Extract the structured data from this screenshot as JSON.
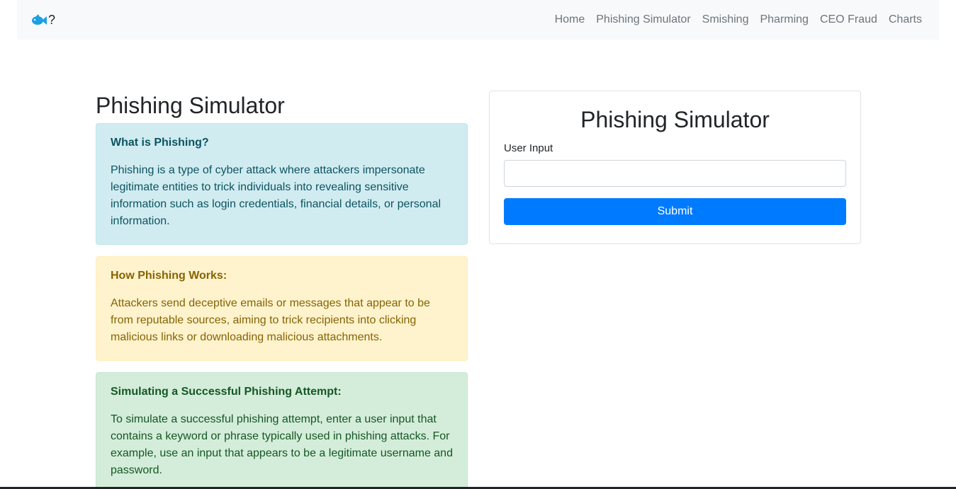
{
  "navbar": {
    "brand_icon": "fish-icon",
    "brand_text": "?",
    "links": [
      "Home",
      "Phishing Simulator",
      "Smishing",
      "Pharming",
      "CEO Fraud",
      "Charts"
    ]
  },
  "main": {
    "title": "Phishing Simulator",
    "alerts": [
      {
        "heading": "What is Phishing?",
        "text": "Phishing is a type of cyber attack where attackers impersonate legitimate entities to trick individuals into revealing sensitive information such as login credentials, financial details, or personal information."
      },
      {
        "heading": "How Phishing Works:",
        "text": "Attackers send deceptive emails or messages that appear to be from reputable sources, aiming to trick recipients into clicking malicious links or downloading malicious attachments."
      },
      {
        "heading": "Simulating a Successful Phishing Attempt:",
        "text": "To simulate a successful phishing attempt, enter a user input that contains a keyword or phrase typically used in phishing attacks. For example, use an input that appears to be a legitimate username and password."
      }
    ]
  },
  "form": {
    "title": "Phishing Simulator",
    "input_label": "User Input",
    "input_value": "",
    "submit_label": "Submit"
  },
  "colors": {
    "primary": "#007bff",
    "info_bg": "#d1ecf1",
    "warning_bg": "#fff3cd",
    "success_bg": "#d4edda",
    "fish": "#1ba1e2"
  }
}
